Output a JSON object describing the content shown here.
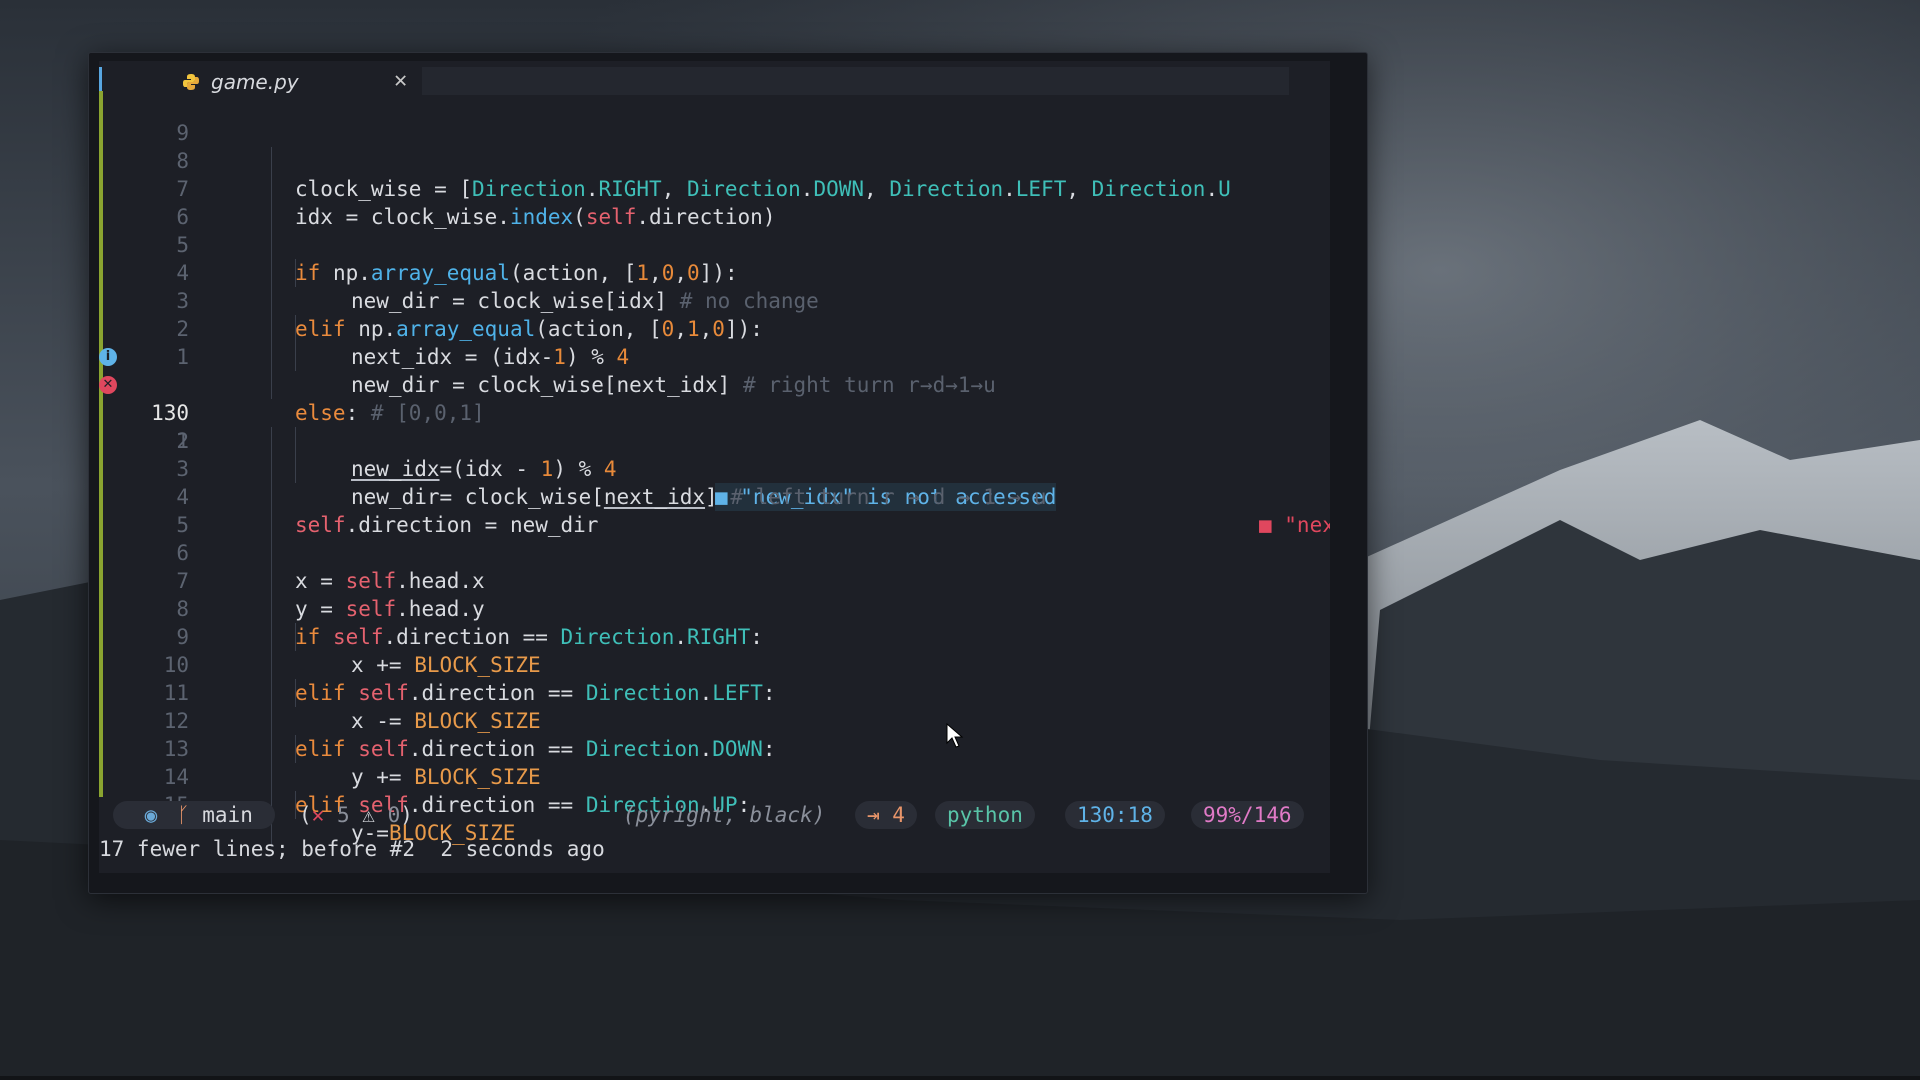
{
  "window": {
    "close_glyph": "✖"
  },
  "tab": {
    "filename": "game.py",
    "close_glyph": "✕",
    "icon": "python-icon"
  },
  "diagnostics": {
    "info_icon": "i",
    "error_icon": "✕",
    "info_text": "■ \"new_idx\" is not accessed",
    "error_text": "■ \"nex"
  },
  "lines": [
    {
      "n": "9",
      "indent": 2,
      "code": "clock_wise = [Direction.RIGHT, Direction.DOWN, Direction.LEFT, Direction.U"
    },
    {
      "n": "8",
      "indent": 2,
      "code": "idx = clock_wise.index(self.direction)"
    },
    {
      "n": "7",
      "indent": 2,
      "code": ""
    },
    {
      "n": "6",
      "indent": 2,
      "code": "if np.array_equal(action, [1,0,0]):"
    },
    {
      "n": "5",
      "indent": 3,
      "code": "new_dir = clock_wise[idx] # no change"
    },
    {
      "n": "4",
      "indent": 2,
      "code": "elif np.array_equal(action, [0,1,0]):"
    },
    {
      "n": "3",
      "indent": 3,
      "code": "next_idx = (idx-1) % 4"
    },
    {
      "n": "2",
      "indent": 3,
      "code": "new_dir = clock_wise[next_idx] # right turn r→d→1→u"
    },
    {
      "n": "1",
      "indent": 2,
      "code": "else: # [0,0,1]"
    },
    {
      "n": "130",
      "indent": 3,
      "code": "new_idx=(idx - 1) % 4"
    },
    {
      "n": "1",
      "indent": 3,
      "code": "new_dir= clock_wise[next_idx] # left turn r → d → 1 → u"
    },
    {
      "n": "2",
      "indent": 2,
      "code": ""
    },
    {
      "n": "3",
      "indent": 2,
      "code": "self.direction = new_dir"
    },
    {
      "n": "4",
      "indent": 2,
      "code": ""
    },
    {
      "n": "5",
      "indent": 2,
      "code": "x = self.head.x"
    },
    {
      "n": "6",
      "indent": 2,
      "code": "y = self.head.y"
    },
    {
      "n": "7",
      "indent": 2,
      "code": "if self.direction == Direction.RIGHT:"
    },
    {
      "n": "8",
      "indent": 3,
      "code": "x += BLOCK_SIZE"
    },
    {
      "n": "9",
      "indent": 2,
      "code": "elif self.direction == Direction.LEFT:"
    },
    {
      "n": "10",
      "indent": 3,
      "code": "x -= BLOCK_SIZE"
    },
    {
      "n": "11",
      "indent": 2,
      "code": "elif self.direction == Direction.DOWN:"
    },
    {
      "n": "12",
      "indent": 3,
      "code": "y += BLOCK_SIZE"
    },
    {
      "n": "13",
      "indent": 2,
      "code": "elif self.direction == Direction.UP:"
    },
    {
      "n": "14",
      "indent": 3,
      "code": "y-=BLOCK_SIZE"
    },
    {
      "n": "15",
      "indent": 2,
      "code": ""
    }
  ],
  "status": {
    "mode_icon": "◉",
    "branch_icon": "ᚴ",
    "branch": "main",
    "errors_icon": "✕",
    "errors": "5",
    "warnings_icon": "⚠",
    "warnings": "0",
    "lsp": "pyright, black",
    "indent": "⇥ 4",
    "language": "python",
    "position": "130:18",
    "progress": "99%/146"
  },
  "message": "17 fewer lines; before #2  2 seconds ago",
  "colors": {
    "keyword": "#ea8b3d",
    "self": "#e5626f",
    "class": "#3fbfb8",
    "function": "#4fb2e8",
    "number": "#e88a3a",
    "comment": "#5a616e",
    "info": "#5fb3e8",
    "error": "#e0475e",
    "git_added": "#8aa430"
  }
}
